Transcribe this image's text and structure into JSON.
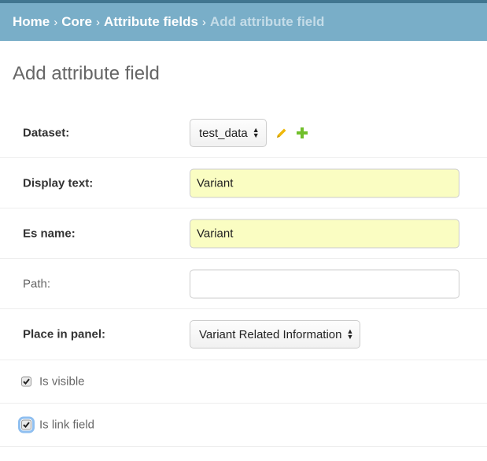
{
  "breadcrumbs": {
    "home": "Home",
    "core": "Core",
    "attribute_fields": "Attribute fields",
    "current": "Add attribute field",
    "separator": "›"
  },
  "page": {
    "title": "Add attribute field"
  },
  "form": {
    "dataset": {
      "label": "Dataset:",
      "selected": "test_data",
      "edit_icon": "pencil-icon",
      "add_icon": "plus-icon"
    },
    "display_text": {
      "label": "Display text:",
      "value": "Variant"
    },
    "es_name": {
      "label": "Es name:",
      "value": "Variant"
    },
    "path": {
      "label": "Path:",
      "value": ""
    },
    "place_in_panel": {
      "label": "Place in panel:",
      "selected": "Variant Related Information"
    },
    "is_visible": {
      "label": "Is visible",
      "checked": true
    },
    "is_link_field": {
      "label": "Is link field",
      "checked": true
    }
  },
  "colors": {
    "header_bar": "#79aec8",
    "header_topline": "#417690",
    "autofill_bg": "#fafdc2",
    "pencil": "#efb80b",
    "plus": "#70bf2b"
  }
}
